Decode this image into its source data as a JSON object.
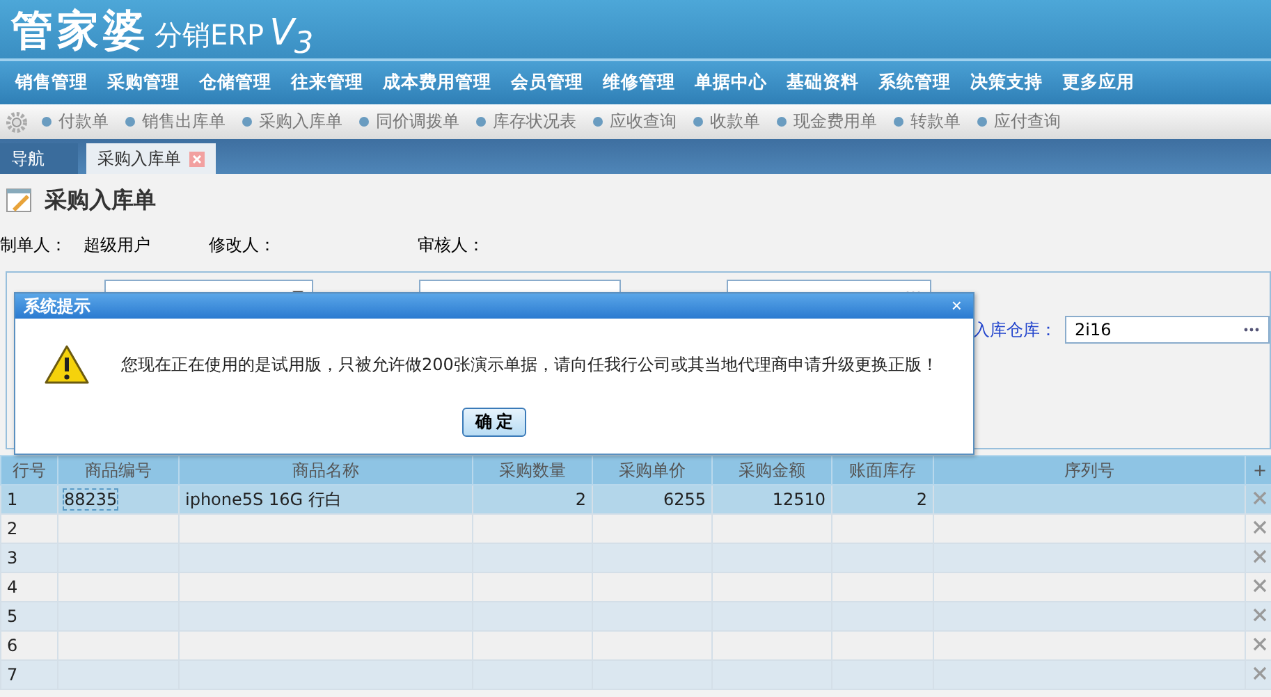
{
  "logo": {
    "brand": "管家婆",
    "product": "分销ERP",
    "version": "V$_{3}$"
  },
  "main_menu": [
    "销售管理",
    "采购管理",
    "仓储管理",
    "往来管理",
    "成本费用管理",
    "会员管理",
    "维修管理",
    "单据中心",
    "基础资料",
    "系统管理",
    "决策支持",
    "更多应用"
  ],
  "quick_bar": [
    "付款单",
    "销售出库单",
    "采购入库单",
    "同价调拨单",
    "库存状况表",
    "应收查询",
    "收款单",
    "现金费用单",
    "转款单",
    "应付查询"
  ],
  "tabs": [
    {
      "label": "导航",
      "selected": false,
      "closable": false
    },
    {
      "label": "采购入库单",
      "selected": true,
      "closable": true
    }
  ],
  "page_title": "采购入库单",
  "meta": [
    {
      "label": "制单人：",
      "value": "超级用户"
    },
    {
      "label": "修改人："
    },
    {
      "label": "审核人："
    }
  ],
  "form_rows": [
    [
      {
        "kind": "date"
      },
      {
        "kind": "text"
      },
      {
        "kind": "lookup"
      }
    ],
    [
      {
        "label": "入库仓库：",
        "value": "2i16",
        "kind": "lookup"
      }
    ]
  ],
  "table": {
    "columns": [
      "行号",
      "商品编号",
      "商品名称",
      "采购数量",
      "采购单价",
      "采购金额",
      "账面库存",
      "序列号"
    ],
    "add_symbol": "+",
    "rows": [
      {
        "cells": [
          "1",
          "88235",
          "iphone5S 16G 行白",
          "2",
          "6255",
          "12510",
          "2",
          ""
        ],
        "selected": true
      },
      {
        "cells": [
          "2",
          "",
          "",
          "",
          "",
          "",
          "",
          ""
        ],
        "selected": false
      },
      {
        "cells": [
          "3",
          "",
          "",
          "",
          "",
          "",
          "",
          ""
        ],
        "selected": false
      },
      {
        "cells": [
          "4",
          "",
          "",
          "",
          "",
          "",
          "",
          ""
        ],
        "selected": false
      },
      {
        "cells": [
          "5",
          "",
          "",
          "",
          "",
          "",
          "",
          ""
        ],
        "selected": false
      },
      {
        "cells": [
          "6",
          "",
          "",
          "",
          "",
          "",
          "",
          ""
        ],
        "selected": false
      },
      {
        "cells": [
          "7",
          "",
          "",
          "",
          "",
          "",
          "",
          ""
        ],
        "selected": false
      }
    ]
  },
  "dialog": {
    "title": "系统提示",
    "close": "×",
    "message": "您现在正在使用的是试用版，只被允许做200张演示单据，请向任我行公司或其当地代理商申请升级更换正版！",
    "button": "确 定"
  }
}
